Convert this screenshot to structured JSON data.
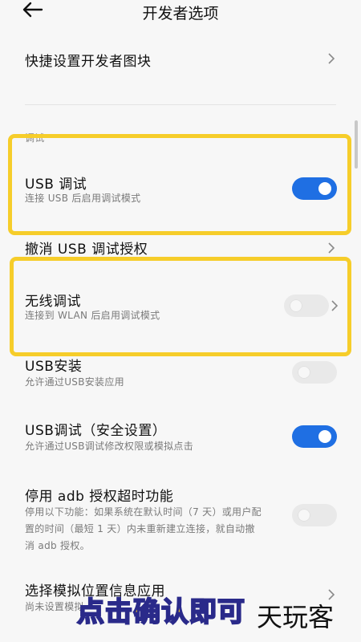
{
  "header": {
    "title": "开发者选项"
  },
  "rows": [
    {
      "id": "quick-tiles",
      "label": "快捷设置开发者图块"
    },
    {
      "id": "section",
      "label": "调试"
    },
    {
      "id": "usb-debug",
      "label": "USB 调试",
      "sub": "连接 USB 后启用调试模式",
      "toggle": "on"
    },
    {
      "id": "revoke-usb",
      "label": "撤消 USB 调试授权"
    },
    {
      "id": "wireless-debug",
      "label": "无线调试",
      "sub": "连接到 WLAN 后启用调试模式",
      "toggle": "off"
    },
    {
      "id": "usb-install",
      "label": "USB安装",
      "sub": "允许通过USB安装应用",
      "toggle": "off"
    },
    {
      "id": "usb-debug-secure",
      "label": "USB调试（安全设置）",
      "sub": "允许通过USB调试修改权限或模拟点击",
      "toggle": "on"
    },
    {
      "id": "adb-timeout",
      "label": "停用 adb 授权超时功能",
      "sub": [
        "停用以下功能：如果系统在默认时间（7 天）或用户配",
        "置的时间（最短 1 天）内未重新建立连接，就自动撤",
        "消 adb 授权。"
      ],
      "toggle": "off"
    },
    {
      "id": "mock-location",
      "label": "选择模拟位置信息应用",
      "sub": "尚未设置模拟"
    }
  ],
  "overlay": {
    "caption": "点击确认即可",
    "brand": "天玩客"
  },
  "colors": {
    "accent": "#1f6fe3",
    "highlight": "#f6cd2a"
  }
}
